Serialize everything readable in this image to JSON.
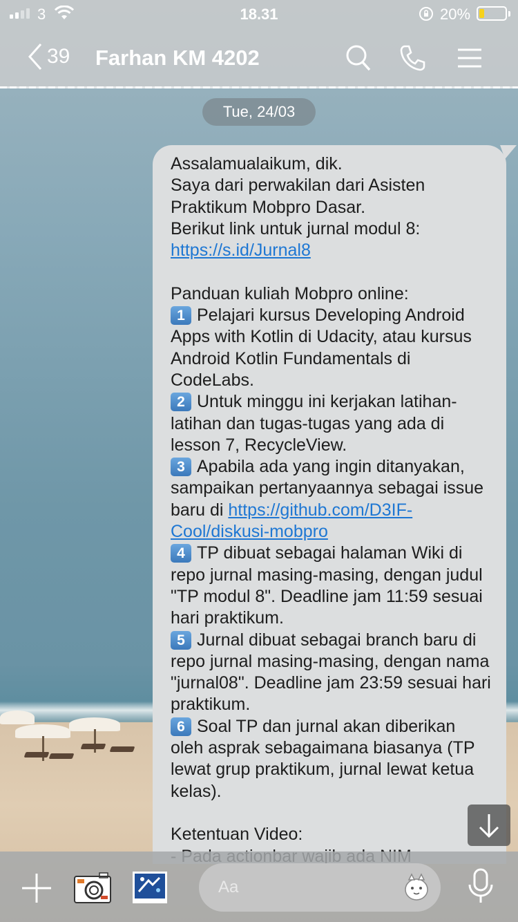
{
  "status_bar": {
    "carrier": "3",
    "time": "18.31",
    "battery_percent": "20%",
    "battery_level": 0.2,
    "battery_color": "#f7d21a"
  },
  "nav": {
    "back_count": "39",
    "title": "Farhan KM 4202",
    "icons": [
      "chevron-left-icon",
      "search-icon",
      "phone-icon",
      "menu-icon"
    ]
  },
  "chat": {
    "date": "Tue, 24/03",
    "message": {
      "greeting": "Assalamualaikum, dik.",
      "intro": "Saya dari perwakilan dari Asisten Praktikum Mobpro Dasar.",
      "link_intro": "Berikut link untuk jurnal modul 8:",
      "link1": "https://s.id/Jurnal8",
      "guide_title": "Panduan kuliah Mobpro online:",
      "items": [
        {
          "num": "1",
          "text": "Pelajari kursus Developing Android Apps with Kotlin di Udacity, atau kursus Android Kotlin Fundamentals di CodeLabs."
        },
        {
          "num": "2",
          "text": "Untuk minggu ini kerjakan latihan-latihan dan tugas-tugas yang ada di lesson 7, RecycleView."
        },
        {
          "num": "3",
          "text": "Apabila ada yang ingin ditanyakan, sampaikan pertanyaannya sebagai issue baru di ",
          "link": "https://github.com/D3IF-Cool/diskusi-mobpro"
        },
        {
          "num": "4",
          "text": "TP dibuat sebagai halaman Wiki di repo jurnal masing-masing, dengan judul \"TP modul 8\". Deadline jam 11:59 sesuai hari praktikum."
        },
        {
          "num": "5",
          "text": "Jurnal dibuat sebagai branch baru di repo jurnal masing-masing, dengan nama \"jurnal08\". Deadline jam 23:59 sesuai hari praktikum."
        },
        {
          "num": "6",
          "text": "Soal TP dan jurnal akan diberikan oleh asprak sebagaimana biasanya (TP lewat grup praktikum, jurnal lewat ketua kelas)."
        }
      ],
      "video_title": "Ketentuan Video:",
      "video_line1": "- Pada actionbar wajib ada NIM"
    }
  },
  "input_bar": {
    "placeholder": "Aa",
    "icons": [
      "plus-icon",
      "camera-icon",
      "gallery-icon",
      "sticker-icon",
      "microphone-icon"
    ]
  }
}
